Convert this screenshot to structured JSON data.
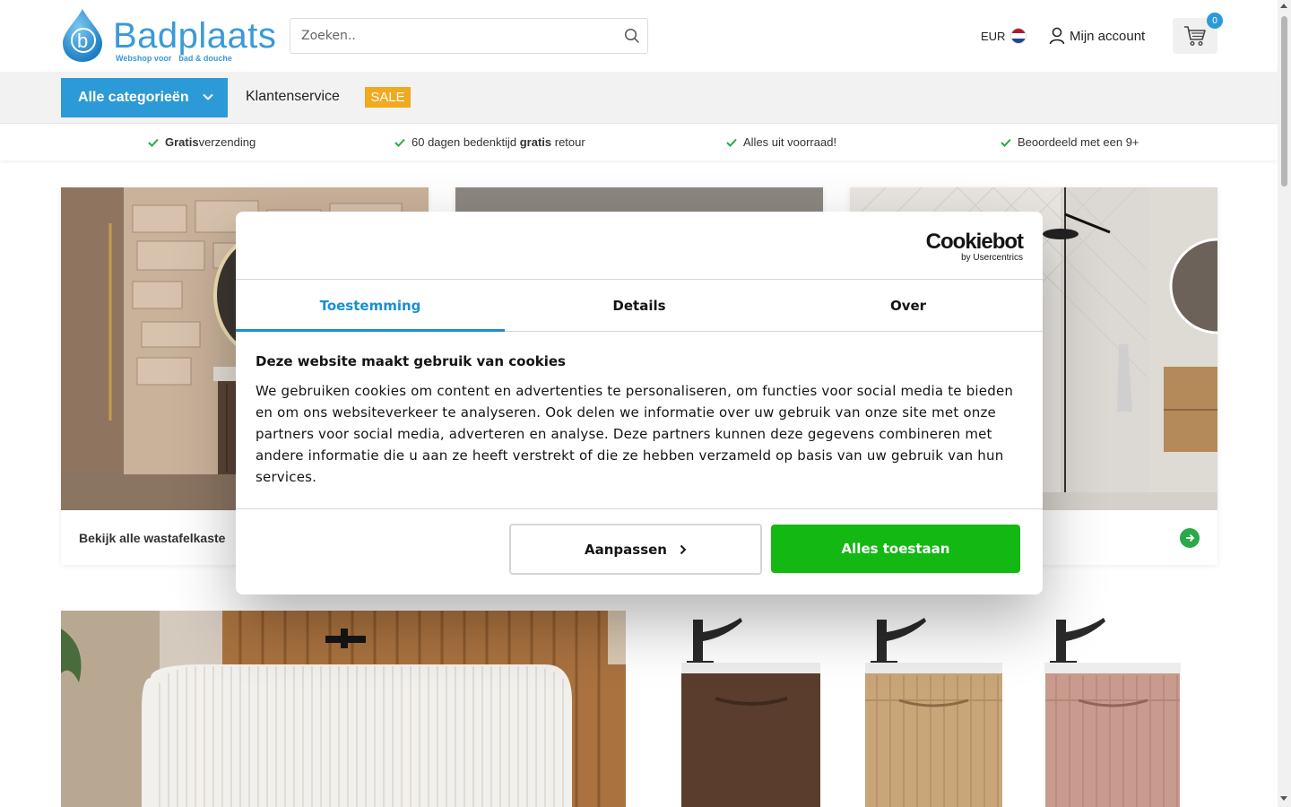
{
  "header": {
    "logo_text": "Badplaats",
    "logo_tagline_a": "Webshop voor",
    "logo_tagline_b": "bad & douche",
    "search_placeholder": "Zoeken..",
    "currency": "EUR",
    "account_label": "Mijn account",
    "cart_count": "0",
    "colors": {
      "brand_blue": "#2c9ad6",
      "sale_orange": "#f2a81f"
    }
  },
  "nav": {
    "categories_label": "Alle categorieën",
    "service_label": "Klantenservice",
    "sale_label": "SALE"
  },
  "usps": [
    {
      "bold_prefix": "Gratis",
      "text": " verzending",
      "bold_suffix": ""
    },
    {
      "bold_prefix": "",
      "text": "60 dagen bedenktijd ",
      "bold_suffix": "gratis",
      "after": " retour"
    },
    {
      "bold_prefix": "",
      "text": "Alles uit voorraad!",
      "bold_suffix": ""
    },
    {
      "bold_prefix": "",
      "text": "Beoordeeld met een 9+",
      "bold_suffix": ""
    }
  ],
  "cards": [
    {
      "label": "Bekijk alle wastafelkaste"
    },
    {
      "label": ""
    },
    {
      "label": ""
    }
  ],
  "cookie_dialog": {
    "brand_main": "Cookiebot",
    "brand_sub": "by Usercentrics",
    "tabs": [
      "Toestemming",
      "Details",
      "Over"
    ],
    "active_tab": "Toestemming",
    "title": "Deze website maakt gebruik van cookies",
    "body": "We gebruiken cookies om content en advertenties te personaliseren, om functies voor social media te bieden en om ons websiteverkeer te analyseren. Ook delen we informatie over uw gebruik van onze site met onze partners voor social media, adverteren en analyse. Deze partners kunnen deze gegevens combineren met andere informatie die u aan ze heeft verstrekt of die ze hebben verzameld op basis van uw gebruik van hun services.",
    "customize_label": "Aanpassen",
    "allow_all_label": "Alles toestaan",
    "colors": {
      "accent": "#1a8fcf",
      "allow_green": "#13b813"
    }
  }
}
